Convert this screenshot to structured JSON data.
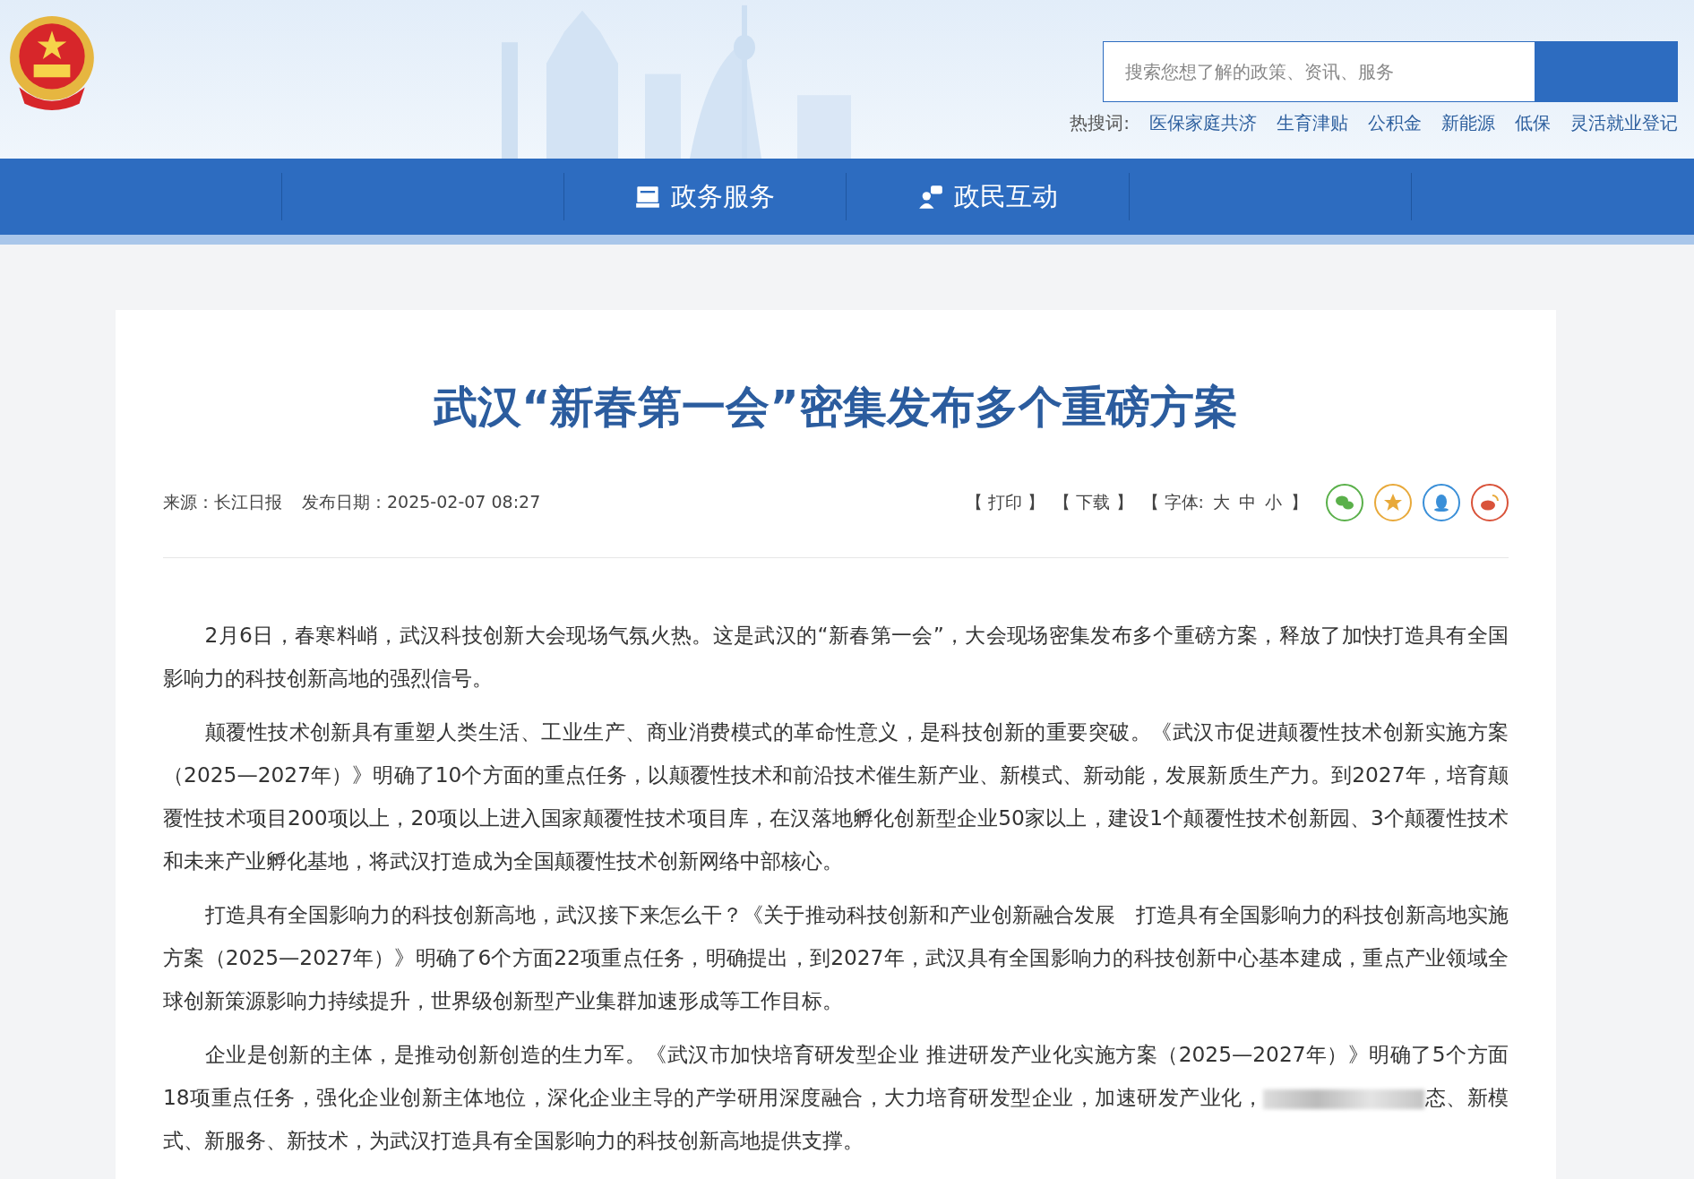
{
  "header": {
    "search": {
      "placeholder": "搜索您想了解的政策、资讯、服务"
    },
    "hot_label": "热搜词:",
    "hot_words": [
      "医保家庭共济",
      "生育津贴",
      "公积金",
      "新能源",
      "低保",
      "灵活就业登记"
    ]
  },
  "nav": {
    "items": [
      {
        "label": "政务服务",
        "kind": "service"
      },
      {
        "label": "政民互动",
        "kind": "interact"
      }
    ]
  },
  "article": {
    "title": "武汉“新春第一会”密集发布多个重磅方案",
    "source": "来源：长江日报",
    "date": "发布日期：2025-02-07 08:27",
    "tools": [
      "【 打印 】",
      "【 下载 】",
      "【 字体:",
      "大",
      "中",
      "小",
      "】"
    ],
    "share": [
      {
        "kind": "wechat",
        "color": "#5ab04a"
      },
      {
        "kind": "favorite",
        "color": "#e8a93a"
      },
      {
        "kind": "qq",
        "color": "#3a8fd8"
      },
      {
        "kind": "weibo",
        "color": "#d9533a"
      }
    ],
    "paragraphs": [
      {
        "text": "2月6日，春寒料峭，武汉科技创新大会现场气氛火热。这是武汉的“新春第一会”，大会现场密集发布多个重磅方案，释放了加快打造具有全国影响力的科技创新高地的强烈信号。",
        "blurred": false
      },
      {
        "text": "颠覆性技术创新具有重塑人类生活、工业生产、商业消费模式的革命性意义，是科技创新的重要突破。《武汉市促进颠覆性技术创新实施方案（2025—2027年）》明确了10个方面的重点任务，以颠覆性技术和前沿技术催生新产业、新模式、新动能，发展新质生产力。到2027年，培育颠覆性技术项目200项以上，20项以上进入国家颠覆性技术项目库，在汉落地孵化创新型企业50家以上，建设1个颠覆性技术创新园、3个颠覆性技术和未来产业孵化基地，将武汉打造成为全国颠覆性技术创新网络中部核心。",
        "blurred": false
      },
      {
        "text": "打造具有全国影响力的科技创新高地，武汉接下来怎么干？《关于推动科技创新和产业创新融合发展　打造具有全国影响力的科技创新高地实施方案（2025—2027年）》明确了6个方面22项重点任务，明确提出，到2027年，武汉具有全国影响力的科技创新中心基本建成，重点产业领域全球创新策源影响力持续提升，世界级创新型产业集群加速形成等工作目标。",
        "blurred": false
      },
      {
        "text": "企业是创新的主体，是推动创新创造的生力军。《武汉市加快培育研发型企业 推进研发产业化实施方案（2025—2027年）》明确了5个方面18项重点任务，强化企业创新主体地位，深化企业主导的产学研用深度融合，大力培育研发型企业，加速研发产业化，",
        "blurred": true,
        "text_after": "态、新模式、新服务、新技术，为武汉打造具有全国影响力的科技创新高地提供支撑。"
      }
    ]
  }
}
